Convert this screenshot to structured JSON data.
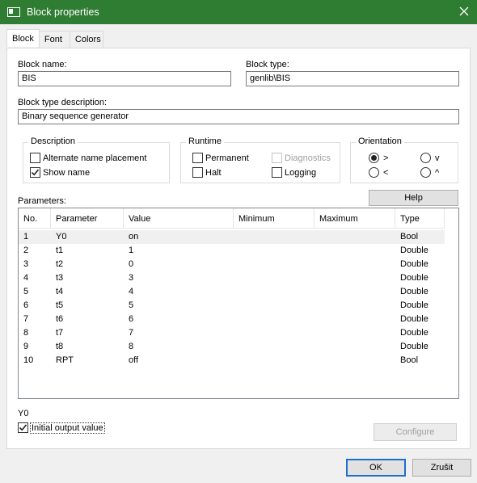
{
  "window": {
    "title": "Block properties"
  },
  "tabs": [
    "Block",
    "Font",
    "Colors"
  ],
  "block_name": {
    "label": "Block name:",
    "value": "BIS"
  },
  "block_type": {
    "label": "Block type:",
    "value": "genlib\\BIS"
  },
  "block_type_description": {
    "label": "Block type description:",
    "value": "Binary sequence generator"
  },
  "description_group": {
    "title": "Description",
    "alternate_name_placement": {
      "label": "Alternate name placement",
      "checked": false
    },
    "show_name": {
      "label": "Show name",
      "checked": true
    }
  },
  "runtime_group": {
    "title": "Runtime",
    "permanent": {
      "label": "Permanent",
      "checked": false
    },
    "halt": {
      "label": "Halt",
      "checked": false
    },
    "diagnostics": {
      "label": "Diagnostics",
      "checked": false,
      "enabled": false
    },
    "logging": {
      "label": "Logging",
      "checked": false
    }
  },
  "orientation_group": {
    "title": "Orientation",
    "options": [
      {
        "label": ">",
        "selected": true
      },
      {
        "label": "v",
        "selected": false
      },
      {
        "label": "<",
        "selected": false
      },
      {
        "label": "^",
        "selected": false
      }
    ]
  },
  "parameters": {
    "label": "Parameters:",
    "help_button": "Help",
    "columns": [
      "No.",
      "Parameter",
      "Value",
      "Minimum",
      "Maximum",
      "Type"
    ],
    "rows": [
      [
        "1",
        "Y0",
        "on",
        "",
        "",
        "Bool"
      ],
      [
        "2",
        "t1",
        "1",
        "",
        "",
        "Double"
      ],
      [
        "3",
        "t2",
        "0",
        "",
        "",
        "Double"
      ],
      [
        "4",
        "t3",
        "3",
        "",
        "",
        "Double"
      ],
      [
        "5",
        "t4",
        "4",
        "",
        "",
        "Double"
      ],
      [
        "6",
        "t5",
        "5",
        "",
        "",
        "Double"
      ],
      [
        "7",
        "t6",
        "6",
        "",
        "",
        "Double"
      ],
      [
        "8",
        "t7",
        "7",
        "",
        "",
        "Double"
      ],
      [
        "9",
        "t8",
        "8",
        "",
        "",
        "Double"
      ],
      [
        "10",
        "RPT",
        "off",
        "",
        "",
        "Bool"
      ]
    ]
  },
  "selected_parameter": {
    "name": "Y0",
    "initial_output_value": {
      "label": "Initial output value",
      "checked": true
    },
    "configure_button": "Configure"
  },
  "footer": {
    "ok": "OK",
    "cancel": "Zrušit"
  }
}
